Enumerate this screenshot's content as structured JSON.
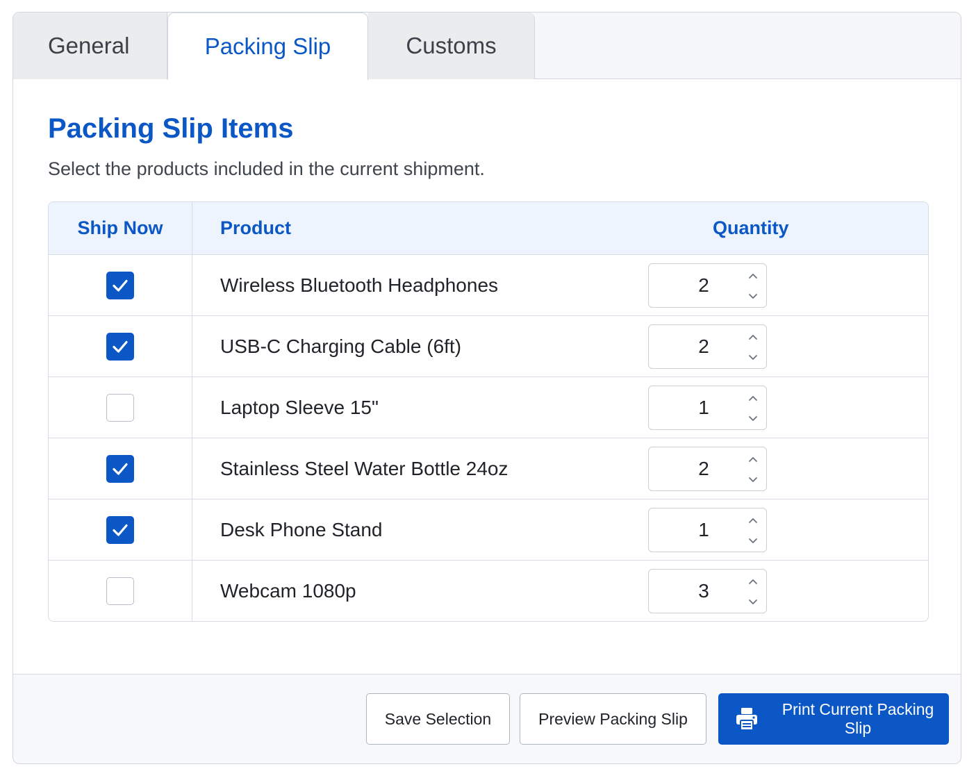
{
  "tabs": [
    {
      "label": "General"
    },
    {
      "label": "Packing Slip"
    },
    {
      "label": "Customs"
    }
  ],
  "active_tab": "Packing Slip",
  "section": {
    "title": "Packing Slip Items",
    "description": "Select the products included in the current shipment."
  },
  "table": {
    "headers": {
      "ship_now": "Ship Now",
      "product": "Product",
      "quantity": "Quantity"
    },
    "rows": [
      {
        "checked": true,
        "product": "Wireless Bluetooth Headphones",
        "quantity": "2"
      },
      {
        "checked": true,
        "product": "USB-C Charging Cable (6ft)",
        "quantity": "2"
      },
      {
        "checked": false,
        "product": "Laptop Sleeve 15\"",
        "quantity": "1"
      },
      {
        "checked": true,
        "product": "Stainless Steel Water Bottle 24oz",
        "quantity": "2"
      },
      {
        "checked": true,
        "product": "Desk Phone Stand",
        "quantity": "1"
      },
      {
        "checked": false,
        "product": "Webcam 1080p",
        "quantity": "3"
      }
    ]
  },
  "footer": {
    "save_label": "Save Selection",
    "preview_label": "Preview Packing Slip",
    "print_label": "Print Current Packing Slip",
    "print_icon": "printer-icon"
  },
  "colors": {
    "accent": "#0b57c5",
    "header_bg": "#eef4fd",
    "tab_inactive_bg": "#ebecee"
  }
}
